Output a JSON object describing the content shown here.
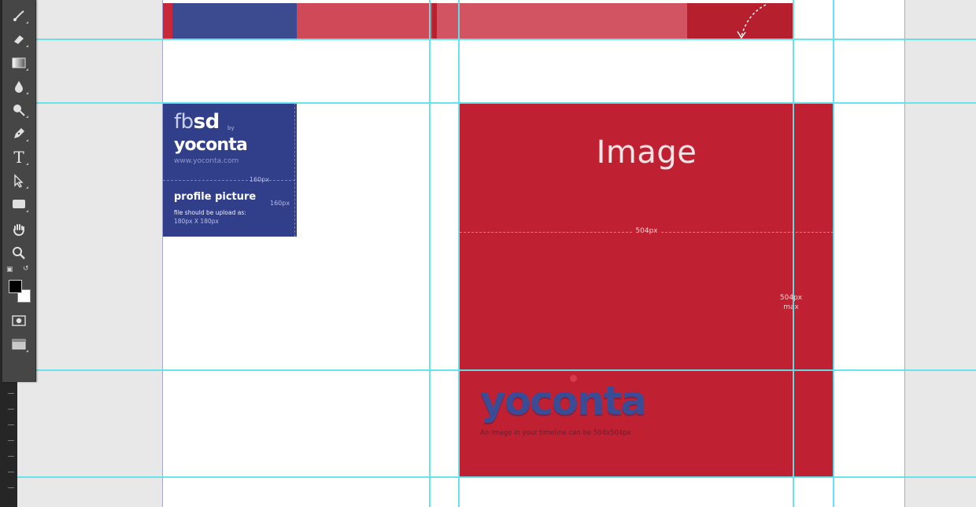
{
  "toolbar": {
    "tools": [
      {
        "id": "brush",
        "icon": "brush-icon"
      },
      {
        "id": "eraser",
        "icon": "eraser-icon"
      },
      {
        "id": "gradient",
        "icon": "gradient-icon"
      },
      {
        "id": "blur",
        "icon": "droplet-icon"
      },
      {
        "id": "dodge",
        "icon": "dodge-icon"
      },
      {
        "id": "pen",
        "icon": "pen-icon"
      },
      {
        "id": "type",
        "icon": "type-icon",
        "glyph": "T"
      },
      {
        "id": "path-selection",
        "icon": "arrow-select-icon"
      },
      {
        "id": "shape",
        "icon": "rectangle-shape-icon"
      },
      {
        "id": "hand",
        "icon": "hand-icon"
      },
      {
        "id": "zoom",
        "icon": "zoom-icon"
      }
    ],
    "colors": {
      "foreground": "#000000",
      "background": "#ffffff"
    }
  },
  "profile_card": {
    "brand_thin": "fb",
    "brand_bold": "sd",
    "brand_by": "by",
    "brand_name": "yoconta",
    "url": "www.yoconta.com",
    "width_label": "160px",
    "height_label": "160px",
    "heading": "profile picture",
    "note_line1": "file should be upload as:",
    "note_line2": "180px X 180px",
    "color": "#313f8b"
  },
  "image_card": {
    "title": "Image",
    "width_label": "504px",
    "height_label_line1": "504px",
    "height_label_line2": "max",
    "logo": "yoconta",
    "caption": "An image in your timeline can be 504x504px",
    "color": "#c02132"
  },
  "colors": {
    "guide": "#60e4ea",
    "pasteboard": "#e8e8e8",
    "top_strip": [
      "#c8283a",
      "#3c4a8f",
      "#cf4958",
      "#d25462",
      "#b51f2e"
    ]
  }
}
